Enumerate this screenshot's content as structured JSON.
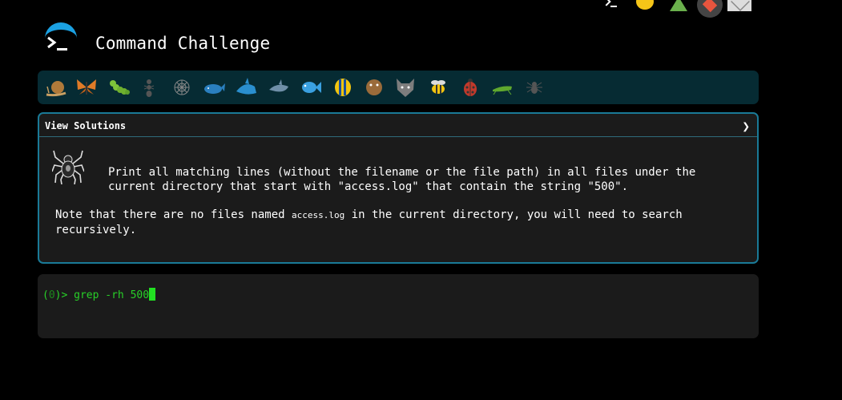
{
  "app": {
    "title": "Command Challenge"
  },
  "topbar": {
    "icons": [
      "terminal-icon",
      "lightbulb-icon",
      "tree-icon",
      "user-avatar",
      "mail-icon"
    ]
  },
  "bugs": [
    {
      "name": "snail",
      "color": "#b07a3a"
    },
    {
      "name": "butterfly",
      "color": "#e07b27"
    },
    {
      "name": "caterpillar",
      "color": "#7ec33a"
    },
    {
      "name": "ant",
      "color": "#555555"
    },
    {
      "name": "spider-web",
      "color": "#888888"
    },
    {
      "name": "whale",
      "color": "#2a7fbf"
    },
    {
      "name": "shark",
      "color": "#2a8fcf"
    },
    {
      "name": "dolphin",
      "color": "#6f8fa8"
    },
    {
      "name": "fish",
      "color": "#3aa0e0"
    },
    {
      "name": "tropical-fish",
      "color": "#f1c40f"
    },
    {
      "name": "pufferfish",
      "color": "#9a6b3a"
    },
    {
      "name": "wolf",
      "color": "#7d7d7d"
    },
    {
      "name": "bee",
      "color": "#f1c40f"
    },
    {
      "name": "ladybug",
      "color": "#c0392b"
    },
    {
      "name": "cricket",
      "color": "#5fa82e"
    },
    {
      "name": "spider",
      "color": "#555555"
    }
  ],
  "panel": {
    "header": "View Solutions",
    "chevron": "❯",
    "description": "Print all matching lines (without the filename or the file path) in all files under the current directory that start with \"access.log\" that contain the string \"500\".",
    "note_before": "Note that there are no files named ",
    "note_code": "access.log",
    "note_after": " in the current directory, you will need to search recursively."
  },
  "terminal": {
    "prompt": "(0)> ",
    "status_code": "0",
    "command": "grep -rh 500"
  },
  "colors": {
    "accent": "#1a7a97",
    "terminal_green": "#28d028",
    "bugbar_bg": "#062b33"
  }
}
